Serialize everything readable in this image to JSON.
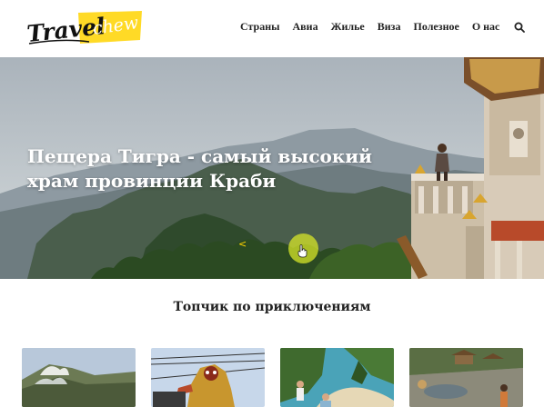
{
  "header": {
    "logo_text": "TravelChew",
    "nav": [
      "Страны",
      "Авиа",
      "Жилье",
      "Виза",
      "Полезное",
      "О нас"
    ],
    "search_icon": "search-icon"
  },
  "hero": {
    "title": "Пещера Тигра - самый высокий храм провинции Краби",
    "prev_arrow": "<",
    "accent_color": "#ffd400"
  },
  "section": {
    "title": "Топчик по приключениям"
  },
  "cards": [
    {
      "image": "volcano-photo"
    },
    {
      "image": "barong-statue-photo"
    },
    {
      "image": "beach-cliff-photo"
    },
    {
      "image": "tropical-resort-photo"
    }
  ]
}
